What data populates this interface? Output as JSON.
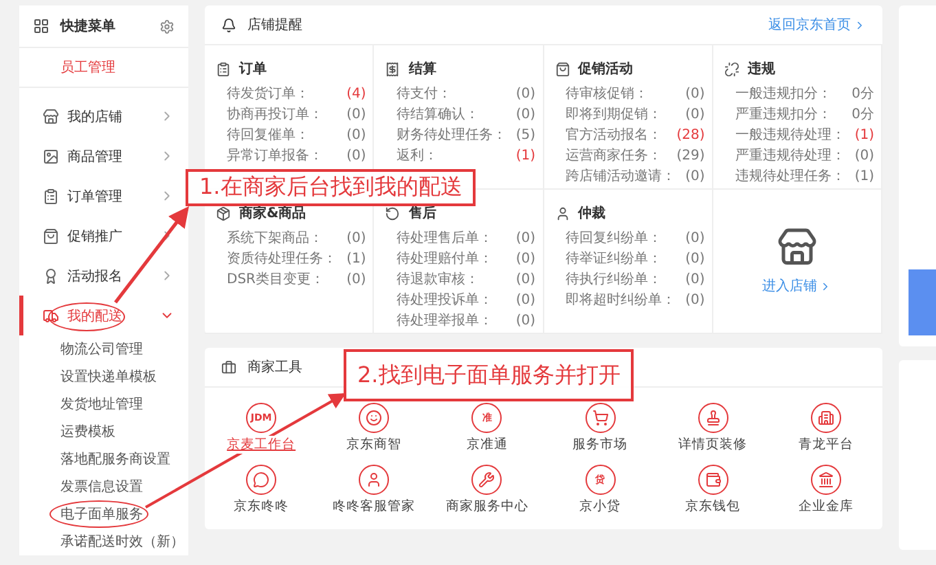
{
  "sidebar": {
    "title": "快捷菜单",
    "pinned": "员工管理",
    "items": [
      {
        "label": "我的店铺",
        "selected": false,
        "expanded": false
      },
      {
        "label": "商品管理",
        "selected": false,
        "expanded": false
      },
      {
        "label": "订单管理",
        "selected": false,
        "expanded": false
      },
      {
        "label": "促销推广",
        "selected": false,
        "expanded": false
      },
      {
        "label": "活动报名",
        "selected": false,
        "expanded": false
      },
      {
        "label": "我的配送",
        "selected": true,
        "expanded": true,
        "children": [
          "物流公司管理",
          "设置快递单模板",
          "发货地址管理",
          "运费模板",
          "落地配服务商设置",
          "发票信息设置",
          "电子面单服务",
          "承诺配送时效（新）"
        ]
      }
    ]
  },
  "reminders": {
    "title": "店铺提醒",
    "link": "返回京东首页",
    "sections": [
      {
        "kind": "list",
        "title": "订单",
        "rows": [
          {
            "label": "待发货订单：",
            "count": "(4)",
            "alert": true
          },
          {
            "label": "协商再投订单：",
            "count": "(0)",
            "alert": false
          },
          {
            "label": "待回复催单：",
            "count": "(0)",
            "alert": false
          },
          {
            "label": "异常订单报备：",
            "count": "(0)",
            "alert": false
          }
        ]
      },
      {
        "kind": "list",
        "title": "结算",
        "rows": [
          {
            "label": "待支付：",
            "count": "(0)",
            "alert": false
          },
          {
            "label": "待结算确认：",
            "count": "(0)",
            "alert": false
          },
          {
            "label": "财务待处理任务：",
            "count": "(5)",
            "alert": false
          },
          {
            "label": "返利：",
            "count": "(1)",
            "alert": true
          }
        ]
      },
      {
        "kind": "list",
        "title": "促销活动",
        "rows": [
          {
            "label": "待审核促销：",
            "count": "(0)",
            "alert": false
          },
          {
            "label": "即将到期促销：",
            "count": "(0)",
            "alert": false
          },
          {
            "label": "官方活动报名：",
            "count": "(28)",
            "alert": true
          },
          {
            "label": "运营商家任务：",
            "count": "(29)",
            "alert": false
          },
          {
            "label": "跨店铺活动邀请：",
            "count": "(0)",
            "alert": false
          }
        ]
      },
      {
        "kind": "list",
        "title": "违规",
        "rows": [
          {
            "label": "一般违规扣分：",
            "count": "0分",
            "alert": false
          },
          {
            "label": "严重违规扣分：",
            "count": "0分",
            "alert": false
          },
          {
            "label": "一般违规待处理：",
            "count": "(1)",
            "alert": true
          },
          {
            "label": "严重违规待处理：",
            "count": "(0)",
            "alert": false
          },
          {
            "label": "违规待处理任务：",
            "count": "(1)",
            "alert": false
          }
        ]
      },
      {
        "kind": "list",
        "title": "商家&商品",
        "rows": [
          {
            "label": "系统下架商品：",
            "count": "(0)",
            "alert": false
          },
          {
            "label": "资质待处理任务：",
            "count": "(1)",
            "alert": false
          },
          {
            "label": "DSR类目变更：",
            "count": "(0)",
            "alert": false
          }
        ]
      },
      {
        "kind": "list",
        "title": "售后",
        "rows": [
          {
            "label": "待处理售后单：",
            "count": "(0)",
            "alert": false
          },
          {
            "label": "待处理赔付单：",
            "count": "(0)",
            "alert": false
          },
          {
            "label": "待退款审核：",
            "count": "(0)",
            "alert": false
          },
          {
            "label": "待处理投诉单：",
            "count": "(0)",
            "alert": false
          },
          {
            "label": "待处理举报单：",
            "count": "(0)",
            "alert": false
          }
        ]
      },
      {
        "kind": "list",
        "title": "仲裁",
        "rows": [
          {
            "label": "待回复纠纷单：",
            "count": "(0)",
            "alert": false
          },
          {
            "label": "待举证纠纷单：",
            "count": "(0)",
            "alert": false
          },
          {
            "label": "待执行纠纷单：",
            "count": "(0)",
            "alert": false
          },
          {
            "label": "即将超时纠纷单：",
            "count": "(0)",
            "alert": false
          }
        ]
      },
      {
        "kind": "store",
        "link": "进入店铺"
      }
    ]
  },
  "tools": {
    "title": "商家工具",
    "items": [
      {
        "label": "京麦工作台",
        "glyph": "JDM",
        "hovered": true
      },
      {
        "label": "京东商智",
        "hovered": false
      },
      {
        "label": "京准通",
        "glyph": "准",
        "hovered": false
      },
      {
        "label": "服务市场",
        "hovered": false
      },
      {
        "label": "详情页装修",
        "hovered": false
      },
      {
        "label": "青龙平台",
        "hovered": false
      },
      {
        "label": "京东咚咚",
        "hovered": false
      },
      {
        "label": "咚咚客服管家",
        "hovered": false
      },
      {
        "label": "商家服务中心",
        "hovered": false
      },
      {
        "label": "京小贷",
        "glyph": "贷",
        "hovered": false
      },
      {
        "label": "京东钱包",
        "hovered": false
      },
      {
        "label": "企业金库",
        "hovered": false
      }
    ]
  },
  "annotations": [
    {
      "kind": "callout",
      "text": "1.在商家后台找到我的配送"
    },
    {
      "kind": "callout",
      "text": "2.找到电子面单服务并打开"
    }
  ]
}
